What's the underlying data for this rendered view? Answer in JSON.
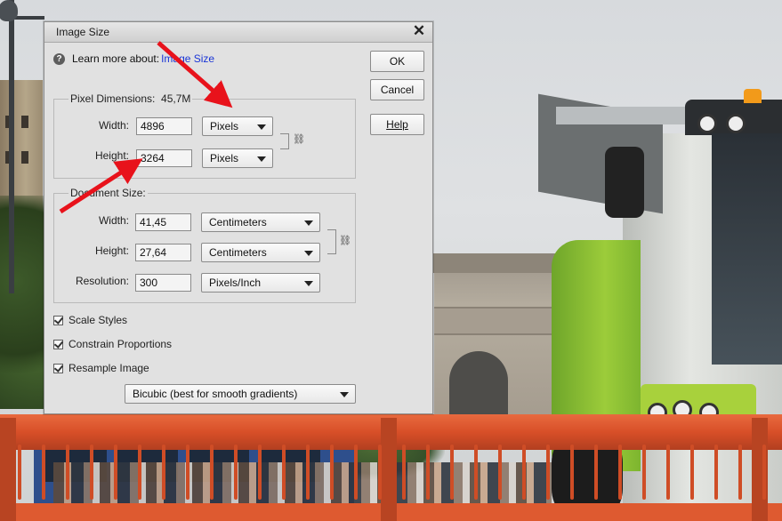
{
  "dialog": {
    "title": "Image Size",
    "close_glyph": "✕",
    "learn_more_text": "Learn more about:",
    "learn_more_link": "Image Size",
    "buttons": {
      "ok": "OK",
      "cancel": "Cancel",
      "help": "Help"
    },
    "pixel_dimensions": {
      "label": "Pixel Dimensions:",
      "size": "45,7M",
      "width_label": "Width:",
      "width_value": "4896",
      "width_unit": "Pixels",
      "height_label": "Height:",
      "height_value": "3264",
      "height_unit": "Pixels"
    },
    "document_size": {
      "label": "Document Size:",
      "width_label": "Width:",
      "width_value": "41,45",
      "width_unit": "Centimeters",
      "height_label": "Height:",
      "height_value": "27,64",
      "height_unit": "Centimeters",
      "resolution_label": "Resolution:",
      "resolution_value": "300",
      "resolution_unit": "Pixels/Inch"
    },
    "checkboxes": [
      {
        "label": "Scale Styles",
        "checked": true
      },
      {
        "label": "Constrain Proportions",
        "checked": true
      },
      {
        "label": "Resample Image",
        "checked": true
      }
    ],
    "resample_method": "Bicubic (best for smooth gradients)"
  },
  "colors": {
    "annotation_arrow": "#e8121b",
    "dialog_bg": "#e1e1e1",
    "link": "#1a35d6"
  },
  "icons": [
    "help-circle-icon",
    "close-icon",
    "chevron-down-icon",
    "link-chain-icon",
    "checkmark-icon"
  ]
}
